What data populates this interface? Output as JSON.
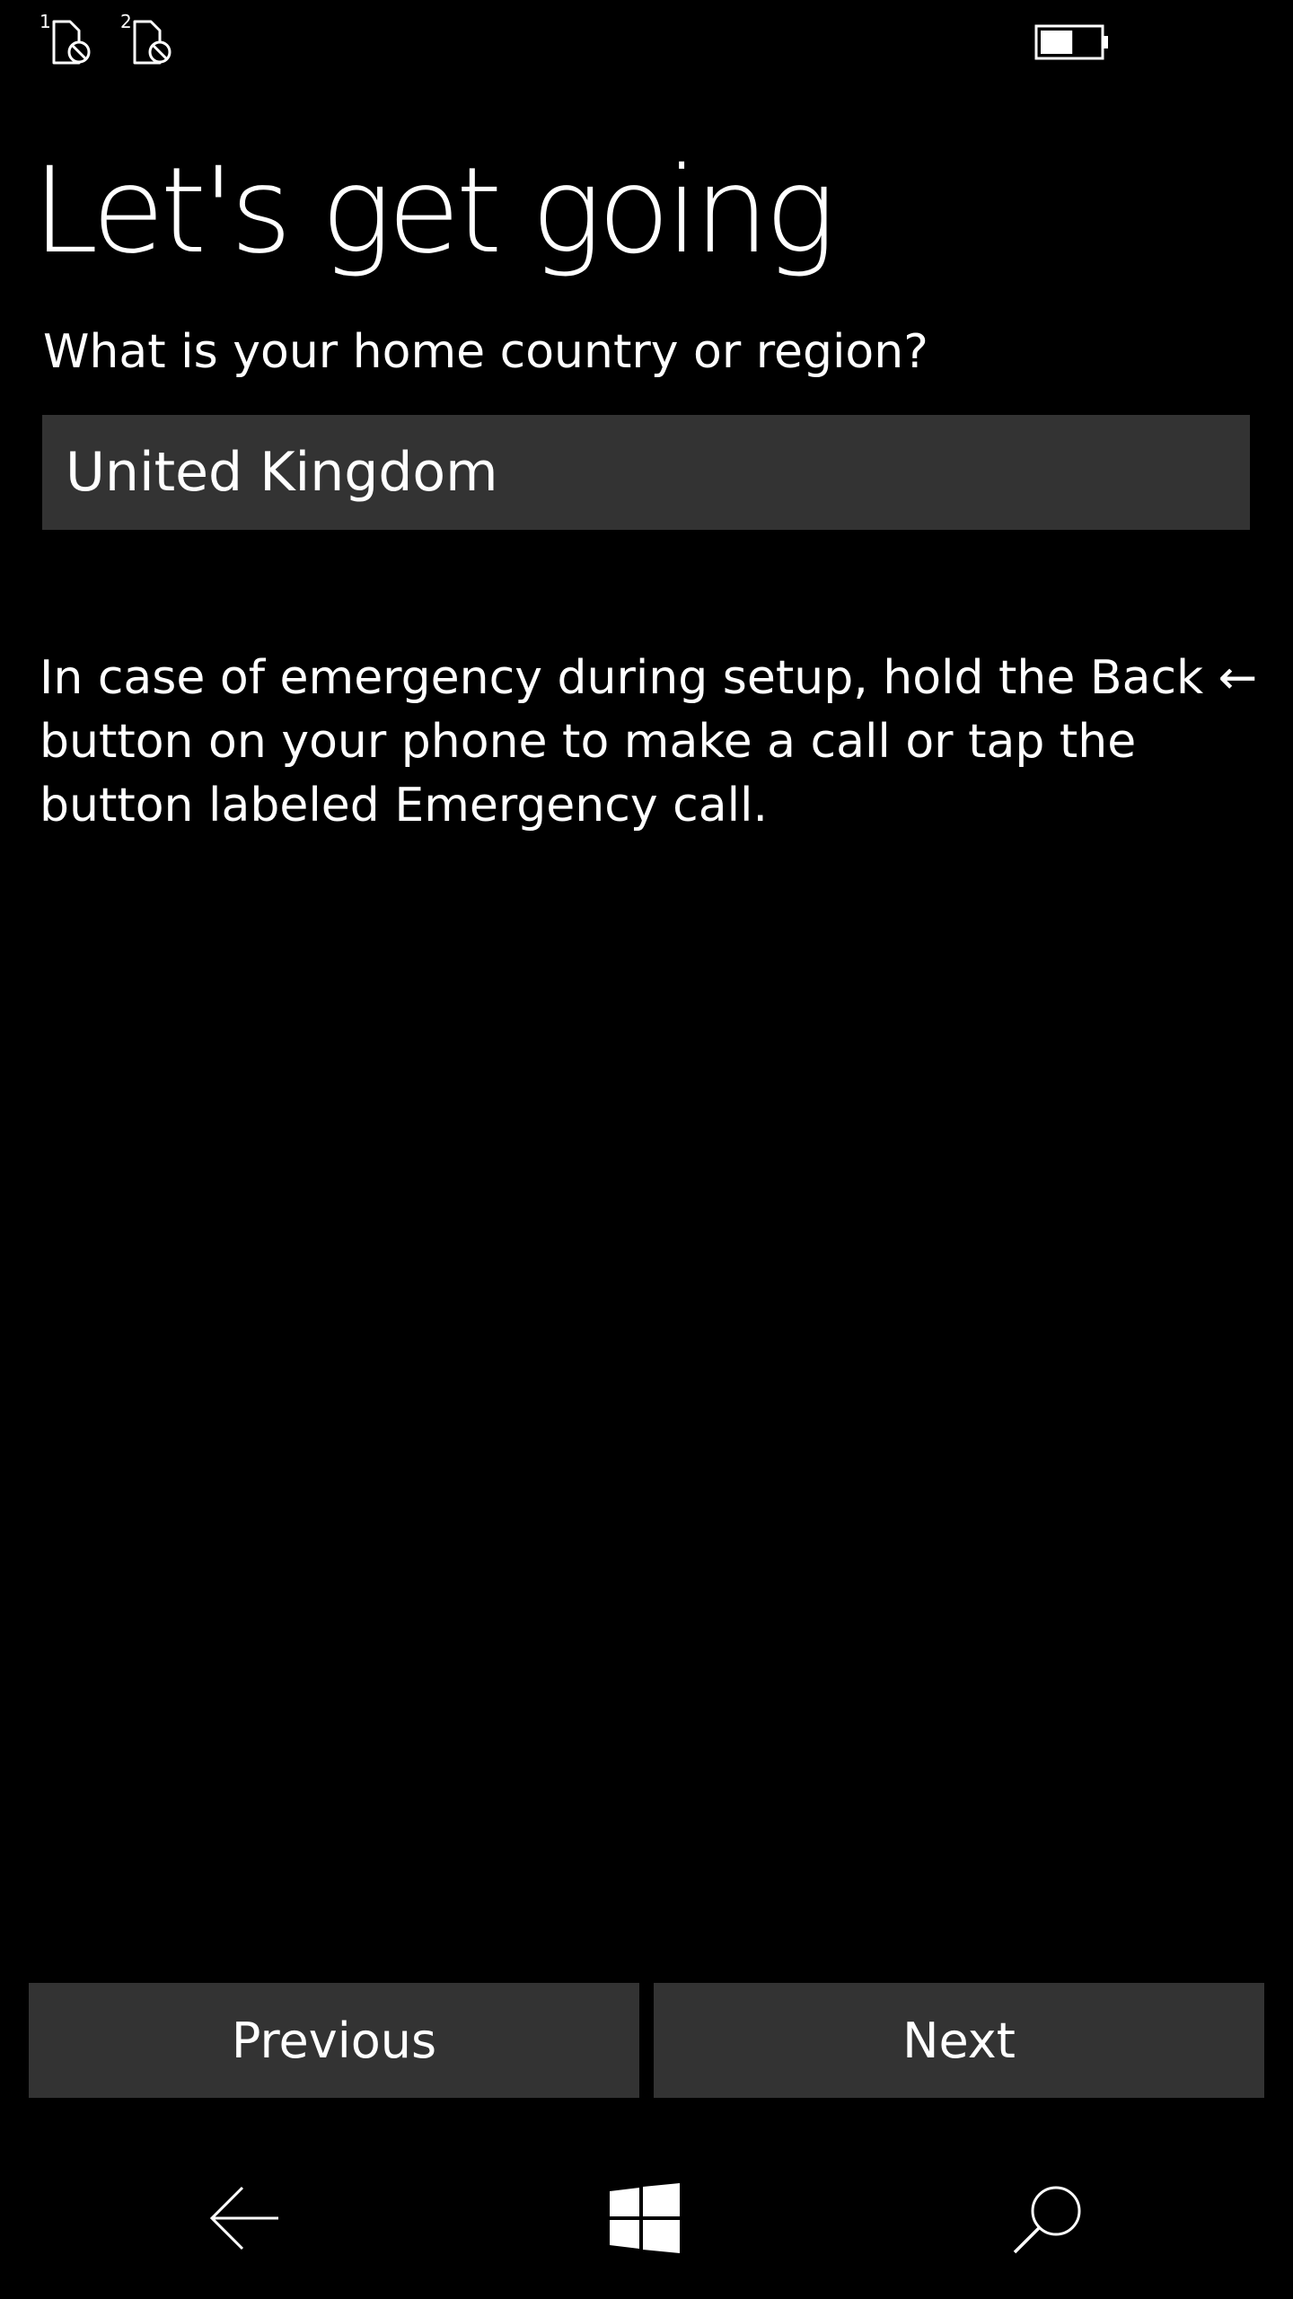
{
  "status_bar": {
    "sim1_label": "1",
    "sim2_label": "2",
    "sim_icon": "sim-no-service-icon",
    "battery_icon": "battery-icon",
    "battery_level": 0.55
  },
  "page": {
    "title": "Let's get going",
    "question": "What is your home country or region?",
    "country_value": "United Kingdom",
    "emergency_text": "In case of emergency during setup, hold the Back ← button on your phone to make a call or tap the button labeled Emergency call."
  },
  "buttons": {
    "previous_label": "Previous",
    "next_label": "Next"
  },
  "nav_bar": {
    "back_icon": "back-arrow-icon",
    "start_icon": "windows-logo-icon",
    "search_icon": "search-icon"
  },
  "colors": {
    "background": "#000000",
    "control": "#333333",
    "text": "#ffffff"
  }
}
